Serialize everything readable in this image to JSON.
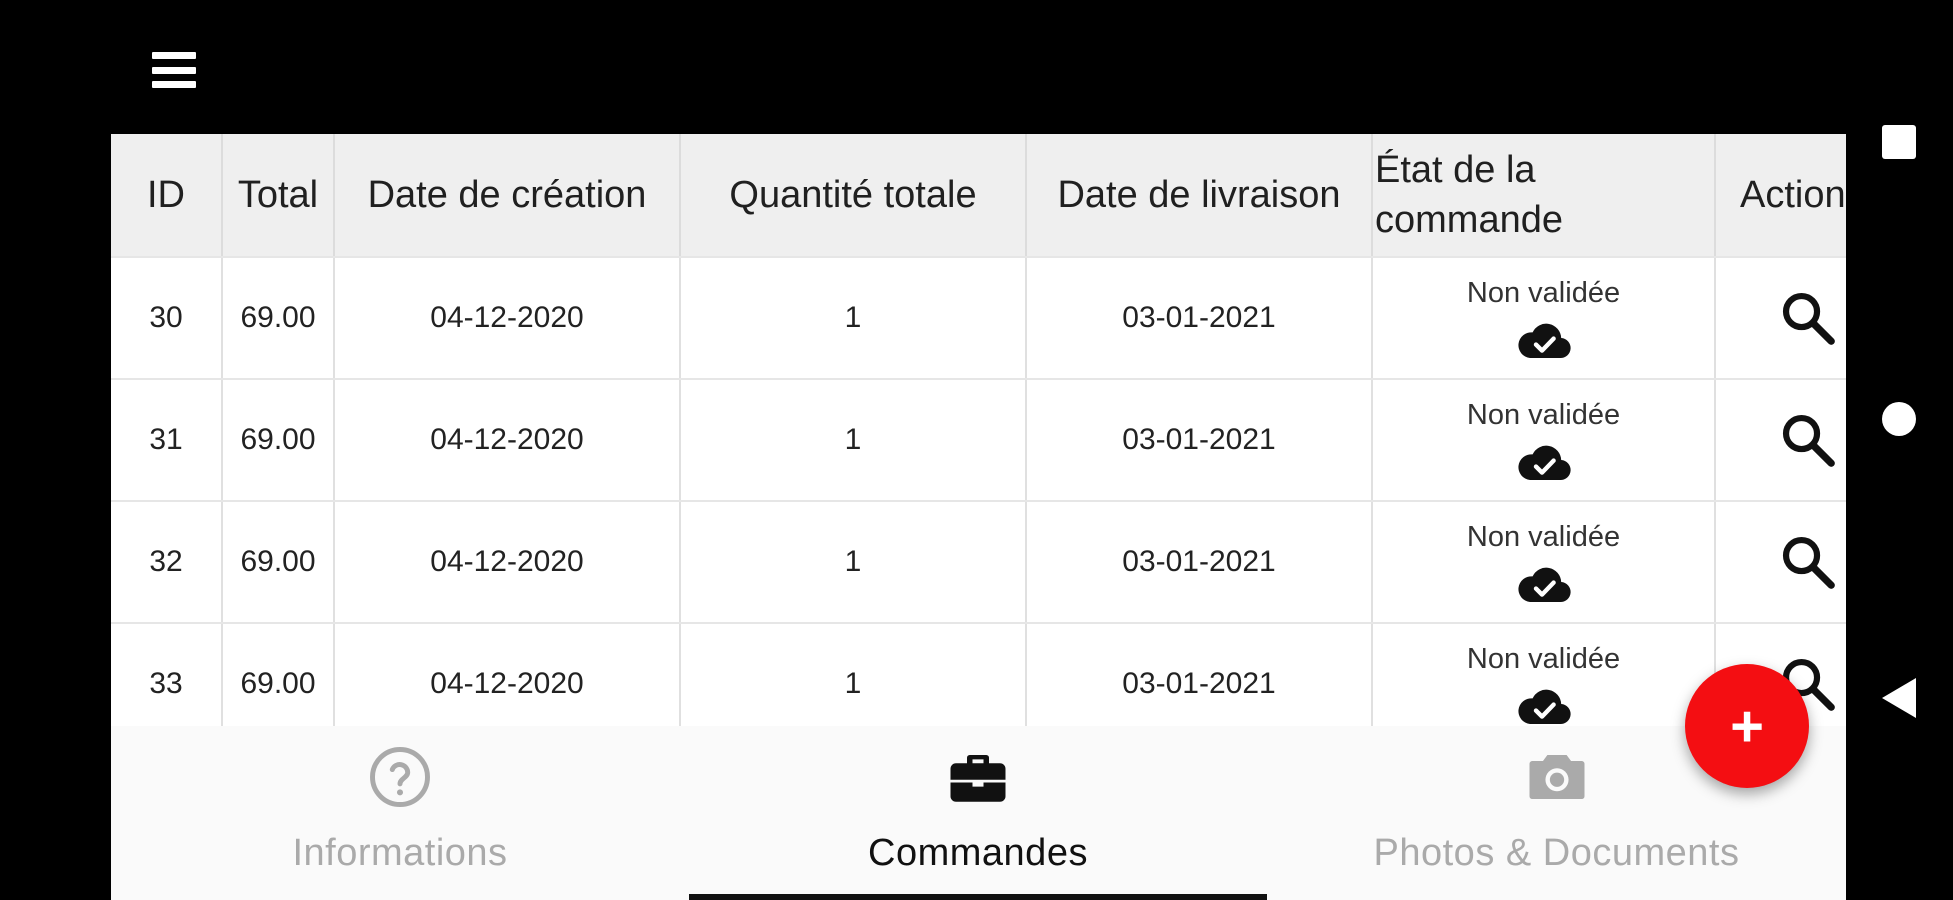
{
  "app_bar": {
    "menu_icon": "hamburger-menu-icon"
  },
  "table": {
    "headers": {
      "id": "ID",
      "total": "Total",
      "date_creation": "Date de création",
      "quantite": "Quantité totale",
      "date_livraison": "Date de livraison",
      "etat": "État de la commande",
      "action": "Action"
    },
    "rows": [
      {
        "id": "30",
        "total": "69.00",
        "date_creation": "04-12-2020",
        "quantite": "1",
        "date_livraison": "03-01-2021",
        "etat": "Non validée"
      },
      {
        "id": "31",
        "total": "69.00",
        "date_creation": "04-12-2020",
        "quantite": "1",
        "date_livraison": "03-01-2021",
        "etat": "Non validée"
      },
      {
        "id": "32",
        "total": "69.00",
        "date_creation": "04-12-2020",
        "quantite": "1",
        "date_livraison": "03-01-2021",
        "etat": "Non validée"
      },
      {
        "id": "33",
        "total": "69.00",
        "date_creation": "04-12-2020",
        "quantite": "1",
        "date_livraison": "03-01-2021",
        "etat": "Non validée"
      }
    ]
  },
  "bottom_nav": {
    "items": [
      {
        "label": "Informations",
        "icon": "help-circle-icon",
        "active": false
      },
      {
        "label": "Commandes",
        "icon": "briefcase-icon",
        "active": true
      },
      {
        "label": "Photos & Documents",
        "icon": "camera-icon",
        "active": false
      }
    ]
  },
  "fab": {
    "label": "+",
    "icon": "plus-icon",
    "color": "#f40e12"
  },
  "colors": {
    "header_bg": "#efefef",
    "active_nav": "#111111",
    "inactive_nav": "#aaaaaa",
    "fab": "#f40e12"
  }
}
